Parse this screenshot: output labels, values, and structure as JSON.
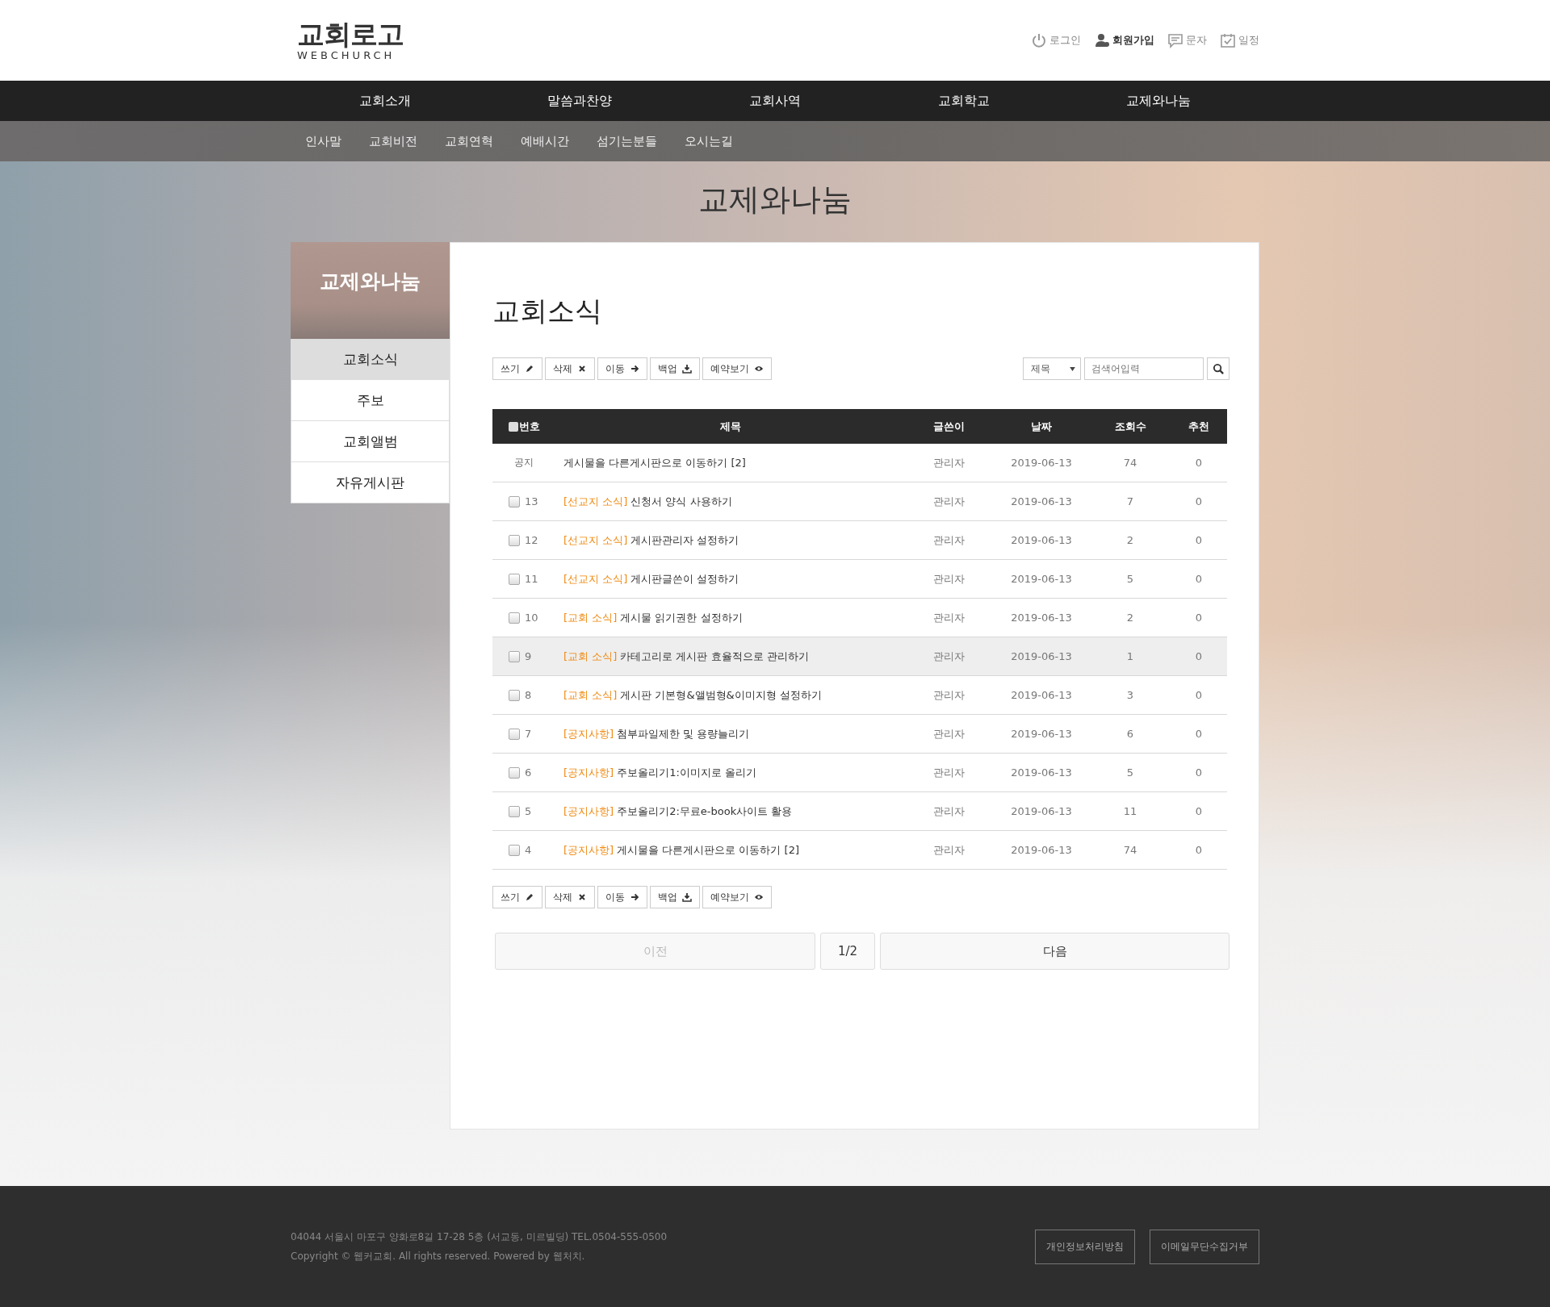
{
  "logo": {
    "title": "교회로고",
    "subtitle": "WEBCHURCH"
  },
  "header_links": [
    {
      "kind": "power",
      "label": "로그인",
      "emphasized": false
    },
    {
      "kind": "user",
      "label": "회원가입",
      "emphasized": true
    },
    {
      "kind": "message",
      "label": "문자",
      "emphasized": false
    },
    {
      "kind": "calendar",
      "label": "일정",
      "emphasized": false
    }
  ],
  "main_nav": [
    "교회소개",
    "말씀과찬양",
    "교회사역",
    "교회학교",
    "교제와나눔"
  ],
  "sub_nav": [
    "인사말",
    "교회비전",
    "교회연혁",
    "예배시간",
    "섬기는분들",
    "오시는길"
  ],
  "page_title": "교제와나눔",
  "sidebar": {
    "title": "교제와나눔",
    "items": [
      {
        "label": "교회소식",
        "selected": true
      },
      {
        "label": "주보",
        "selected": false
      },
      {
        "label": "교회앨범",
        "selected": false
      },
      {
        "label": "자유게시판",
        "selected": false
      }
    ]
  },
  "board_title": "교회소식",
  "toolbar_top": [
    {
      "kind": "pencil",
      "label": "쓰기"
    },
    {
      "kind": "cross",
      "label": "삭제"
    },
    {
      "kind": "arrow",
      "label": "이동"
    },
    {
      "kind": "download",
      "label": "백업"
    },
    {
      "kind": "eye",
      "label": "예약보기"
    }
  ],
  "search": {
    "field": "제목",
    "placeholder": "검색어입력"
  },
  "table": {
    "columns": [
      "번호",
      "제목",
      "글쓴이",
      "날짜",
      "조회수",
      "추천"
    ],
    "select_all_checked": false,
    "rows": [
      {
        "kind": "notice",
        "number": "공지",
        "category": "",
        "title": "게시물을 다른게시판으로 이동하기 [2]",
        "author": "관리자",
        "date": "2019-06-13",
        "views": "74",
        "likes": "0",
        "highlighted": false
      },
      {
        "kind": "post",
        "checked": false,
        "number": "13",
        "category": "[선교지 소식]",
        "title": "신청서 양식 사용하기",
        "author": "관리자",
        "date": "2019-06-13",
        "views": "7",
        "likes": "0",
        "highlighted": false
      },
      {
        "kind": "post",
        "checked": false,
        "number": "12",
        "category": "[선교지 소식]",
        "title": "게시판관리자 설정하기",
        "author": "관리자",
        "date": "2019-06-13",
        "views": "2",
        "likes": "0",
        "highlighted": false
      },
      {
        "kind": "post",
        "checked": false,
        "number": "11",
        "category": "[선교지 소식]",
        "title": "게시판글쓴이 설정하기",
        "author": "관리자",
        "date": "2019-06-13",
        "views": "5",
        "likes": "0",
        "highlighted": false
      },
      {
        "kind": "post",
        "checked": false,
        "number": "10",
        "category": "[교회 소식]",
        "title": "게시물 읽기권한 설정하기",
        "author": "관리자",
        "date": "2019-06-13",
        "views": "2",
        "likes": "0",
        "highlighted": false
      },
      {
        "kind": "post",
        "checked": false,
        "number": "9",
        "category": "[교회 소식]",
        "title": "카테고리로 게시판 효율적으로 관리하기",
        "author": "관리자",
        "date": "2019-06-13",
        "views": "1",
        "likes": "0",
        "highlighted": true
      },
      {
        "kind": "post",
        "checked": false,
        "number": "8",
        "category": "[교회 소식]",
        "title": "게시판 기본형&앨범형&이미지형 설정하기",
        "author": "관리자",
        "date": "2019-06-13",
        "views": "3",
        "likes": "0",
        "highlighted": false
      },
      {
        "kind": "post",
        "checked": false,
        "number": "7",
        "category": "[공지사항]",
        "title": "첨부파일제한 및 용량늘리기",
        "author": "관리자",
        "date": "2019-06-13",
        "views": "6",
        "likes": "0",
        "highlighted": false
      },
      {
        "kind": "post",
        "checked": false,
        "number": "6",
        "category": "[공지사항]",
        "title": "주보올리기1:이미지로 올리기",
        "author": "관리자",
        "date": "2019-06-13",
        "views": "5",
        "likes": "0",
        "highlighted": false
      },
      {
        "kind": "post",
        "checked": false,
        "number": "5",
        "category": "[공지사항]",
        "title": "주보올리기2:무료e-book사이트 활용",
        "author": "관리자",
        "date": "2019-06-13",
        "views": "11",
        "likes": "0",
        "highlighted": false
      },
      {
        "kind": "post",
        "checked": false,
        "number": "4",
        "category": "[공지사항]",
        "title": "게시물을 다른게시판으로 이동하기 [2]",
        "author": "관리자",
        "date": "2019-06-13",
        "views": "74",
        "likes": "0",
        "highlighted": false
      }
    ]
  },
  "toolbar_bottom": [
    {
      "kind": "pencil",
      "label": "쓰기"
    },
    {
      "kind": "cross",
      "label": "삭제"
    },
    {
      "kind": "arrow",
      "label": "이동"
    },
    {
      "kind": "download",
      "label": "백업"
    },
    {
      "kind": "eye",
      "label": "예약보기"
    }
  ],
  "pagination": {
    "previous": {
      "label": "이전",
      "disabled": true
    },
    "page": "1/2",
    "next": {
      "label": "다음",
      "disabled": false
    }
  },
  "footer": {
    "address": "04044 서울시 마포구 양화로8길 17-28 5층 (서교동, 미르빌딩) TEL.0504-555-0500",
    "copyright": "Copyright © 웹커교회. All rights reserved. Powered by 웹처치.",
    "links": [
      "개인정보처리방침",
      "이메일무단수집거부"
    ]
  }
}
